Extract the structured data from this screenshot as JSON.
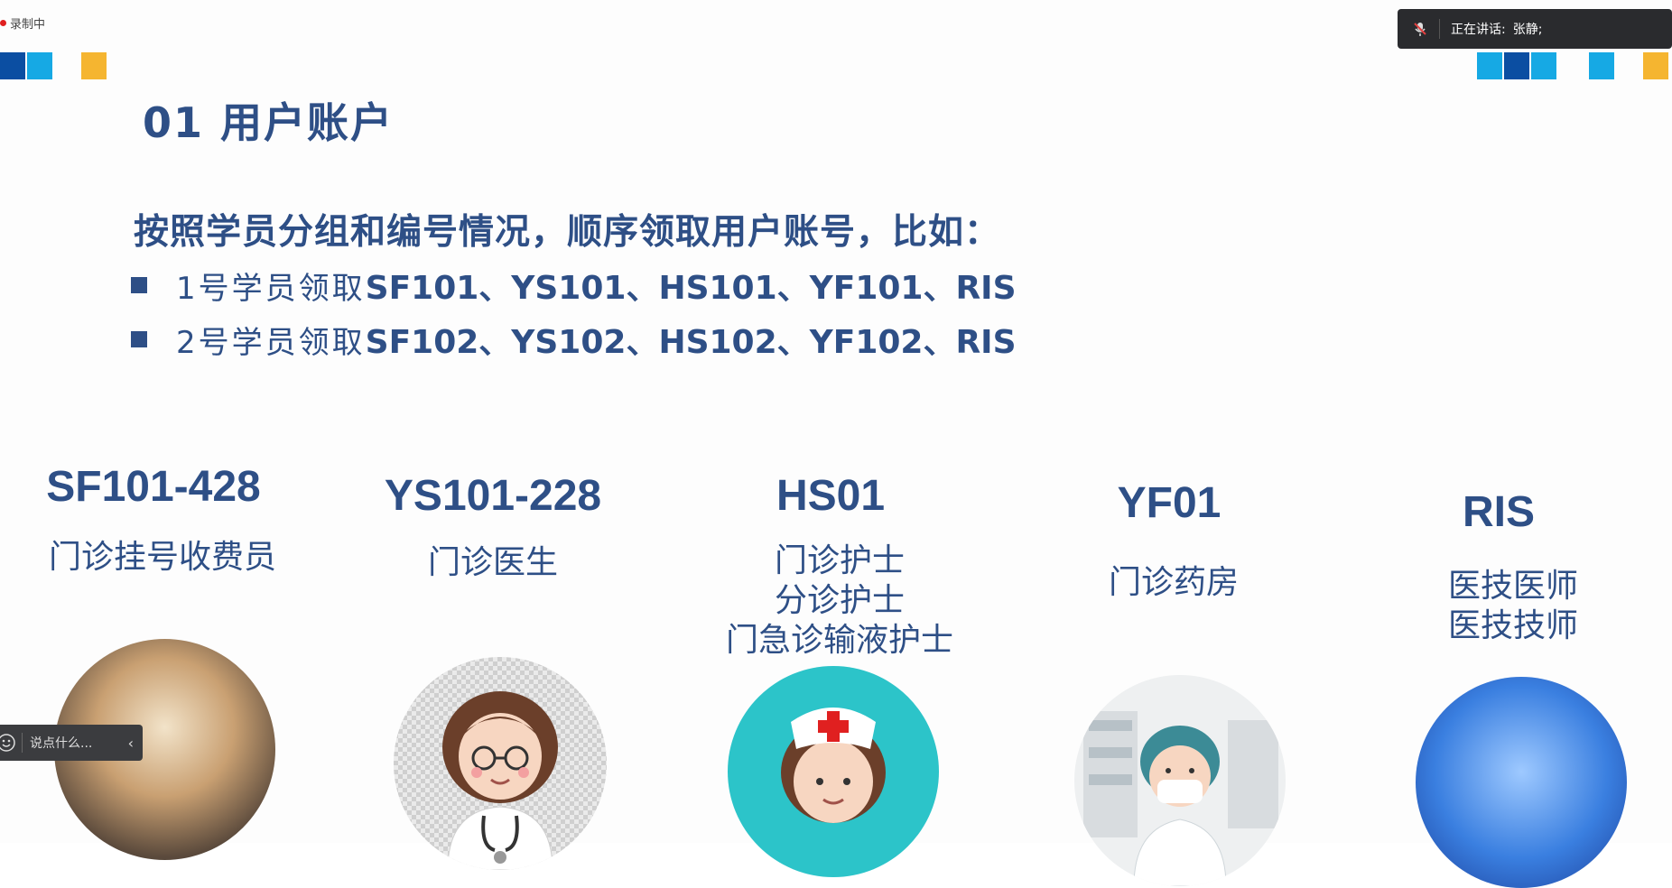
{
  "recording": {
    "label": "录制中"
  },
  "slide": {
    "title": "01  用户账户",
    "subtitle": "按照学员分组和编号情况，顺序领取用户账号，比如：",
    "bullets": [
      {
        "prefix": "1号学员领取",
        "codes": "SF101、YS101、HS101、YF101、RIS"
      },
      {
        "prefix": "2号学员领取",
        "codes": "SF102、YS102、HS102、YF102、RIS"
      }
    ],
    "accounts": [
      {
        "code": "SF101-428",
        "roles": [
          "门诊挂号收费员"
        ],
        "avatar": "cashier-photo"
      },
      {
        "code": "YS101-228",
        "roles": [
          "门诊医生"
        ],
        "avatar": "doctor-icon"
      },
      {
        "code": "HS01",
        "roles": [
          "门诊护士",
          "分诊护士",
          "门急诊输液护士"
        ],
        "avatar": "nurse-icon"
      },
      {
        "code": "YF01",
        "roles": [
          "门诊药房"
        ],
        "avatar": "pharmacist-icon"
      },
      {
        "code": "RIS",
        "roles": [
          "医技医师",
          "医技技师"
        ],
        "avatar": "lab-technician-photo"
      }
    ]
  },
  "speaking_panel": {
    "label": "正在讲话:",
    "speaker": "张静;"
  },
  "chat": {
    "placeholder": "说点什么..."
  },
  "colors": {
    "primary_text": "#2e4f86",
    "dark_blue": "#0b4ea2",
    "light_blue": "#16a9e4",
    "yellow": "#f5b530"
  }
}
